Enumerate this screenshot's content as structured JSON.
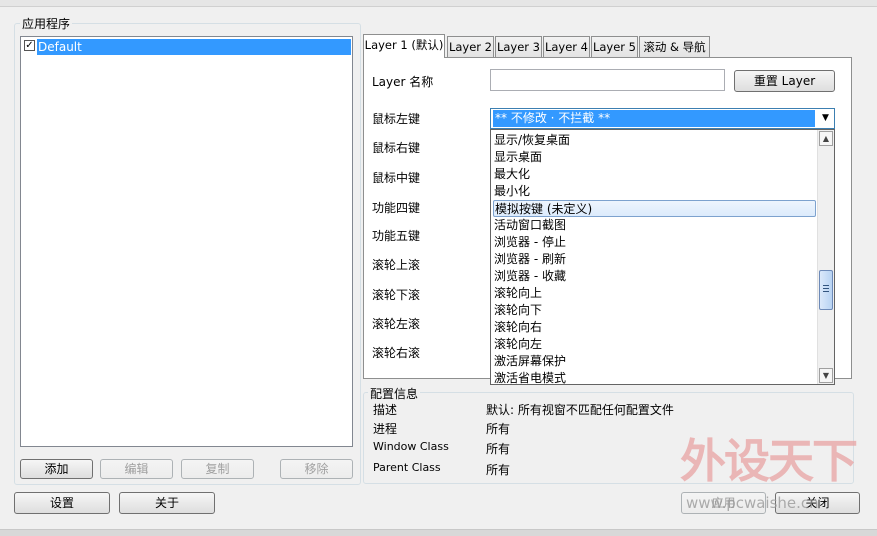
{
  "apps_group": {
    "title": "应用程序",
    "items": [
      {
        "label": "Default",
        "checked": true
      }
    ]
  },
  "app_buttons": {
    "add": "添加",
    "edit": "编辑",
    "copy": "复制",
    "remove": "移除"
  },
  "bottom_buttons": {
    "settings": "设置",
    "about": "关于",
    "apply": "应用",
    "close": "关闭"
  },
  "tabs": [
    "Layer 1 (默认)",
    "Layer 2",
    "Layer 3",
    "Layer 4",
    "Layer 5",
    "滚动 & 导航"
  ],
  "layer": {
    "name_label": "Layer 名称",
    "name_value": "",
    "reset_button": "重置 Layer",
    "rows": [
      "鼠标左键",
      "鼠标右键",
      "鼠标中键",
      "功能四键",
      "功能五键",
      "滚轮上滚",
      "滚轮下滚",
      "滚轮左滚",
      "滚轮右滚"
    ],
    "left_button_value": "** 不修改 · 不拦截 **"
  },
  "dropdown_options": [
    "显示/恢复桌面",
    "显示桌面",
    "最大化",
    "最小化",
    "模拟按键 (未定义)",
    "活动窗口截图",
    "浏览器 - 停止",
    "浏览器 - 刷新",
    "浏览器 - 收藏",
    "滚轮向上",
    "滚轮向下",
    "滚轮向右",
    "滚轮向左",
    "激活屏幕保护",
    "激活省电模式"
  ],
  "dropdown_highlighted_index": 4,
  "config_info": {
    "title": "配置信息",
    "rows": [
      {
        "label": "描述",
        "value": "默认: 所有视窗不匹配任何配置文件"
      },
      {
        "label": "进程",
        "value": "所有"
      },
      {
        "label": "Window Class",
        "value": "所有"
      },
      {
        "label": "Parent Class",
        "value": "所有"
      }
    ]
  },
  "watermark": {
    "brand": "外设天下",
    "url": "www.pcwaishe.cn"
  },
  "colors": {
    "selection": "#3399ff",
    "highlight_border": "#7da2ce",
    "watermark_red": "#e8a3a3"
  },
  "icons": [
    "checkbox-icon",
    "dropdown-arrow-icon",
    "scroll-up-icon",
    "scroll-down-icon"
  ]
}
